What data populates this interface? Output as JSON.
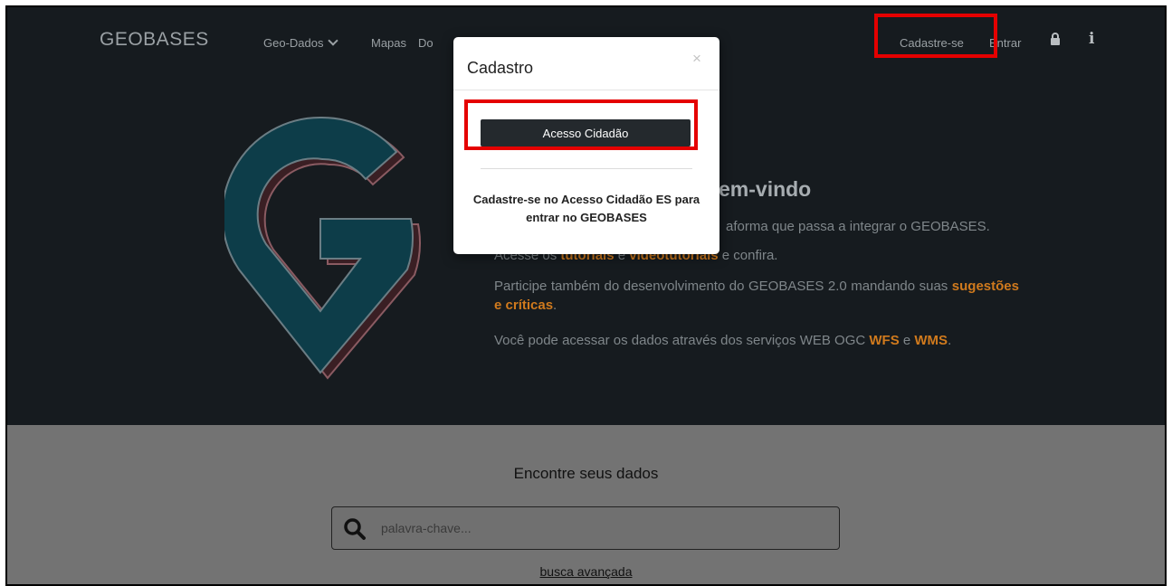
{
  "navbar": {
    "brand": "GEOBASES",
    "items": [
      {
        "label": "Geo-Dados"
      },
      {
        "label": "Mapas"
      },
      {
        "label": "Do"
      }
    ],
    "cadastre": "Cadastre-se",
    "entrar": "Entrar",
    "icons": [
      "lock-icon",
      "info-icon"
    ]
  },
  "hero": {
    "welcome": "em-vindo",
    "line1": "aforma que passa a integrar o GEOBASES.",
    "line2_prefix": "Acesse os ",
    "line2_link1": "tutoriais",
    "line2_mid": " e ",
    "line2_link2": "videotutoriais",
    "line2_suffix": " e confira.",
    "line3": "Participe também do desenvolvimento do GEOBASES 2.0 mandando suas ",
    "line3_link": "sugestões e críticas",
    "line3_end": ".",
    "line4": "Você pode acessar os dados através dos serviços WEB OGC ",
    "line4_link1": "WFS",
    "line4_mid": " e ",
    "line4_link2": "WMS",
    "line4_end": "."
  },
  "search": {
    "title": "Encontre seus dados",
    "placeholder": "palavra-chave...",
    "advanced": "busca avançada"
  },
  "modal": {
    "title": "Cadastro",
    "close": "×",
    "button": "Acesso Cidadão",
    "text": "Cadastre-se no Acesso Cidadão ES para entrar no GEOBASES"
  },
  "colors": {
    "accent_orange": "#d07a1d",
    "highlight_red": "#e50000",
    "logo_teal": "#0d3d49"
  }
}
